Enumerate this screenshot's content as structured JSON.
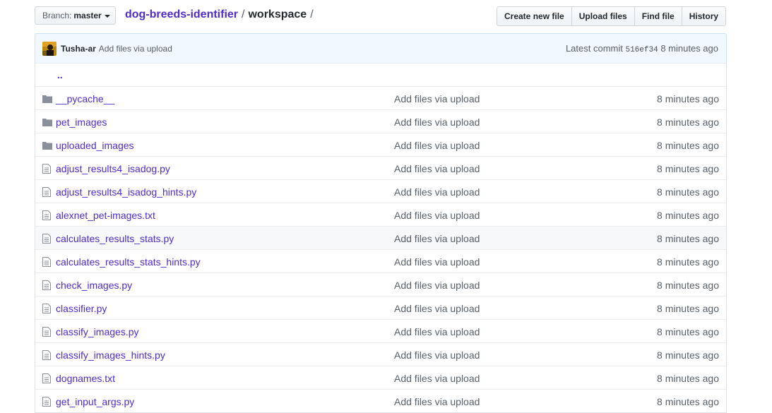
{
  "branch": {
    "label": "Branch:",
    "value": "master"
  },
  "breadcrumb": {
    "repo": "dog-breeds-identifier",
    "sep1": "/",
    "folder": "workspace",
    "sep2": "/"
  },
  "actions": [
    "Create new file",
    "Upload files",
    "Find file",
    "History"
  ],
  "commit": {
    "author": "Tusha-ar",
    "message": "Add files via upload",
    "latest_label": "Latest commit",
    "sha": "516ef34",
    "age": "8 minutes ago"
  },
  "parent_link": "..",
  "files": [
    {
      "name": "__pycache__",
      "type": "dir",
      "message": "Add files via upload",
      "age": "8 minutes ago"
    },
    {
      "name": "pet_images",
      "type": "dir",
      "message": "Add files via upload",
      "age": "8 minutes ago"
    },
    {
      "name": "uploaded_images",
      "type": "dir",
      "message": "Add files via upload",
      "age": "8 minutes ago"
    },
    {
      "name": "adjust_results4_isadog.py",
      "type": "file",
      "message": "Add files via upload",
      "age": "8 minutes ago"
    },
    {
      "name": "adjust_results4_isadog_hints.py",
      "type": "file",
      "message": "Add files via upload",
      "age": "8 minutes ago"
    },
    {
      "name": "alexnet_pet-images.txt",
      "type": "file",
      "message": "Add files via upload",
      "age": "8 minutes ago"
    },
    {
      "name": "calculates_results_stats.py",
      "type": "file",
      "message": "Add files via upload",
      "age": "8 minutes ago"
    },
    {
      "name": "calculates_results_stats_hints.py",
      "type": "file",
      "message": "Add files via upload",
      "age": "8 minutes ago"
    },
    {
      "name": "check_images.py",
      "type": "file",
      "message": "Add files via upload",
      "age": "8 minutes ago"
    },
    {
      "name": "classifier.py",
      "type": "file",
      "message": "Add files via upload",
      "age": "8 minutes ago"
    },
    {
      "name": "classify_images.py",
      "type": "file",
      "message": "Add files via upload",
      "age": "8 minutes ago"
    },
    {
      "name": "classify_images_hints.py",
      "type": "file",
      "message": "Add files via upload",
      "age": "8 minutes ago"
    },
    {
      "name": "dognames.txt",
      "type": "file",
      "message": "Add files via upload",
      "age": "8 minutes ago"
    },
    {
      "name": "get_input_args.py",
      "type": "file",
      "message": "Add files via upload",
      "age": "8 minutes ago"
    }
  ],
  "highlighted_row": 6,
  "colors": {
    "link": "#4d2ccc",
    "muted": "#586069",
    "folder_icon": "#8a8f9c",
    "commit_bg": "#f1f8ff"
  }
}
